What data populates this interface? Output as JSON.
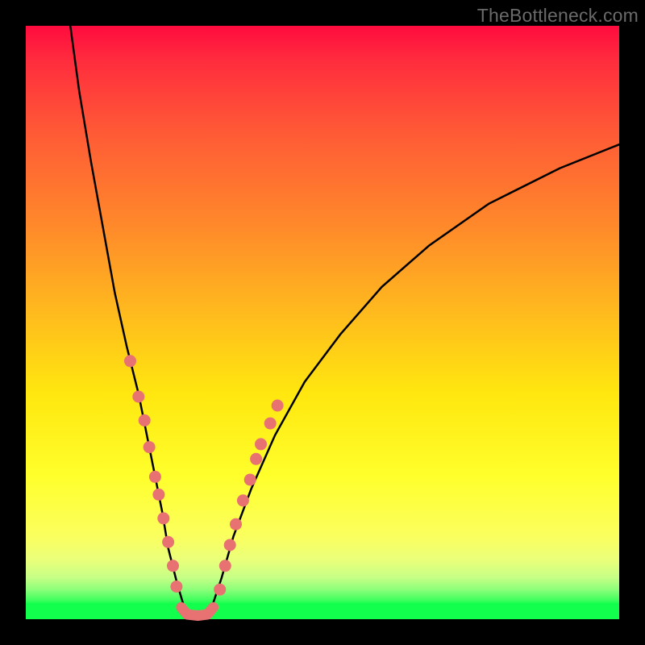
{
  "watermark": "TheBottleneck.com",
  "chart_data": {
    "type": "line",
    "title": "",
    "xlabel": "",
    "ylabel": "",
    "xlim": [
      0,
      100
    ],
    "ylim": [
      100,
      0
    ],
    "grid": false,
    "legend": false,
    "note": "Axis values are approximate percentages of the plot area (x left→right, y top(100)→bottom(0)). All values estimated visually.",
    "series": [
      {
        "name": "curve-left",
        "style": "solid-black",
        "x": [
          7.5,
          9,
          11,
          13,
          15,
          17,
          19,
          21,
          23,
          24,
          25.5,
          27
        ],
        "y": [
          100,
          89,
          77,
          66,
          55,
          46,
          38,
          28,
          18,
          12,
          6,
          1
        ]
      },
      {
        "name": "curve-right",
        "style": "solid-black",
        "x": [
          31,
          33,
          35,
          38,
          42,
          47,
          53,
          60,
          68,
          78,
          90,
          100
        ],
        "y": [
          1,
          7,
          14,
          22,
          31,
          40,
          48,
          56,
          63,
          70,
          76,
          80
        ]
      },
      {
        "name": "valley-floor",
        "style": "thick-salmon",
        "x": [
          26.2,
          27.2,
          29.0,
          30.6,
          31.6
        ],
        "y": [
          2.0,
          0.8,
          0.6,
          0.8,
          2.0
        ]
      }
    ],
    "scatter": [
      {
        "name": "dots-left",
        "color": "salmon",
        "x": [
          17.6,
          19.0,
          20.0,
          20.8,
          21.8,
          22.4,
          23.2,
          24.0,
          24.8,
          25.4
        ],
        "y": [
          43.5,
          37.5,
          33.5,
          29.0,
          24.0,
          21.0,
          17.0,
          13.0,
          9.0,
          5.5
        ]
      },
      {
        "name": "dots-right",
        "color": "salmon",
        "x": [
          32.7,
          33.6,
          34.4,
          35.4,
          36.6,
          37.8,
          38.8,
          39.6,
          41.2,
          42.4
        ],
        "y": [
          5.0,
          9.0,
          12.5,
          16.0,
          20.0,
          23.5,
          27.0,
          29.5,
          33.0,
          36.0
        ]
      }
    ]
  }
}
